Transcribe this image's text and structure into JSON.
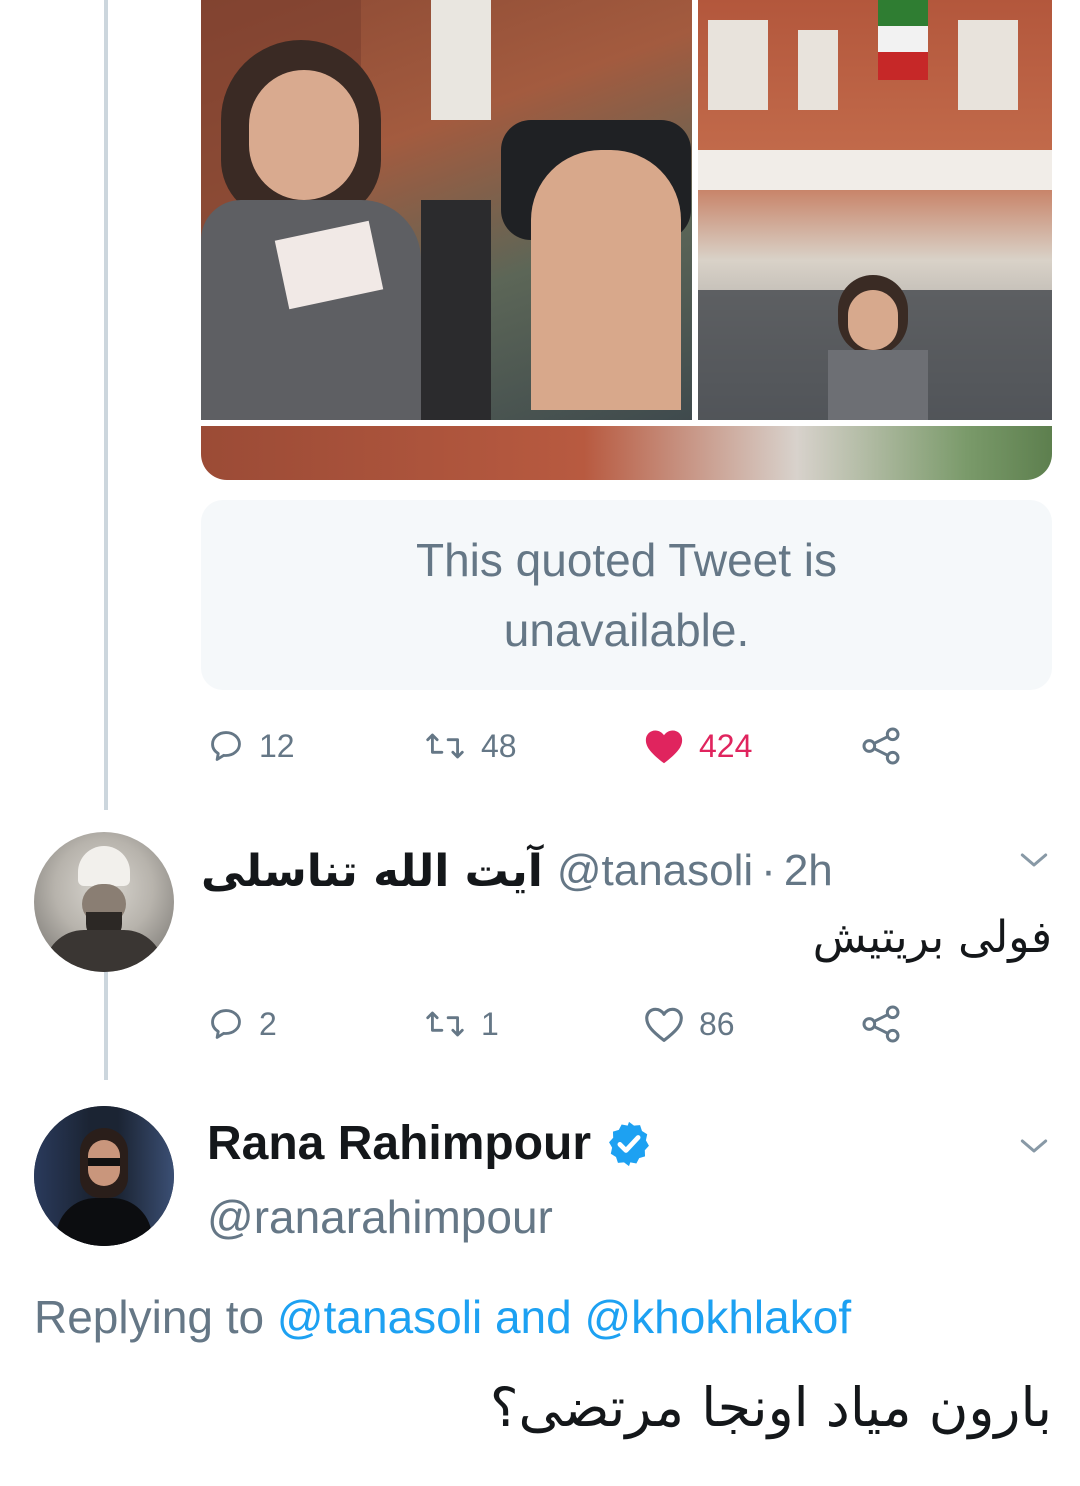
{
  "tweet": {
    "quoted_unavailable": "This quoted Tweet is unavailable.",
    "actions": {
      "replies": "12",
      "retweets": "48",
      "likes": "424",
      "liked": true
    },
    "icons": [
      "reply-icon",
      "retweet-icon",
      "heart-icon",
      "share-icon"
    ]
  },
  "reply1": {
    "display_name": "آیت الله تناسلی",
    "handle": "@tanasoli",
    "separator": "·",
    "time": "2h",
    "text": "فولی بریتیش",
    "actions": {
      "replies": "2",
      "retweets": "1",
      "likes": "86"
    }
  },
  "reply2": {
    "display_name": "Rana Rahimpour",
    "verified": true,
    "handle": "@ranarahimpour",
    "replying_prefix": "Replying to",
    "mention1": "@tanasoli",
    "conjunction": "and",
    "mention2": "@khokhlakof",
    "text": "بارون میاد اونجا مرتضی؟"
  },
  "colors": {
    "link_blue": "#1da1f2",
    "like_red": "#e0245e",
    "secondary_text": "#657786",
    "thread_line": "#ccd6dd",
    "quoted_bg": "#f5f8fa"
  }
}
